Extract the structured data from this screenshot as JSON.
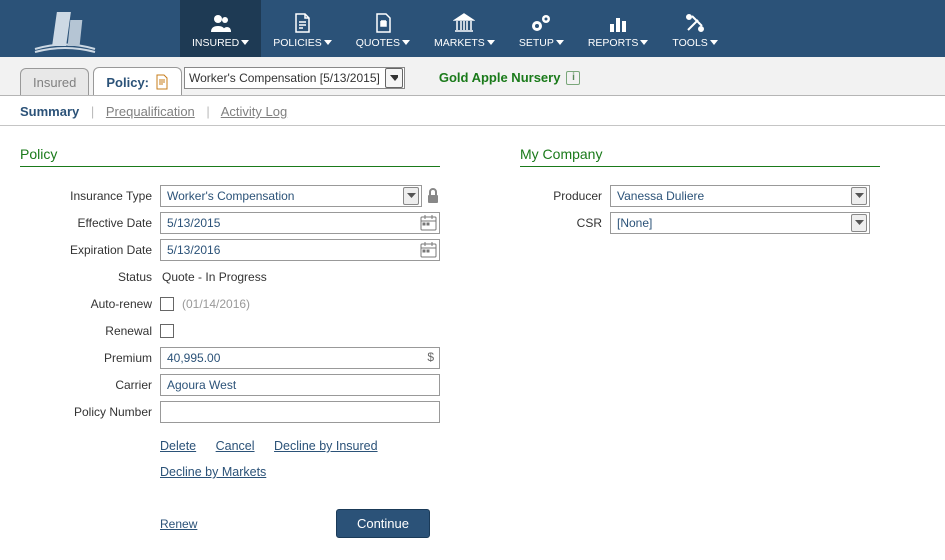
{
  "nav": {
    "items": [
      {
        "label": "INSURED"
      },
      {
        "label": "POLICIES"
      },
      {
        "label": "QUOTES"
      },
      {
        "label": "MARKETS"
      },
      {
        "label": "SETUP"
      },
      {
        "label": "REPORTS"
      },
      {
        "label": "TOOLS"
      }
    ]
  },
  "subtabs": {
    "insured": "Insured",
    "policy_label": "Policy:",
    "policy_selected": "Worker's Compensation [5/13/2015]",
    "company_name": "Gold Apple Nursery"
  },
  "tertiary": {
    "summary": "Summary",
    "prequal": "Prequalification",
    "activity": "Activity Log"
  },
  "policy": {
    "title": "Policy",
    "labels": {
      "insurance_type": "Insurance Type",
      "effective_date": "Effective Date",
      "expiration_date": "Expiration Date",
      "status": "Status",
      "auto_renew": "Auto-renew",
      "renewal": "Renewal",
      "premium": "Premium",
      "carrier": "Carrier",
      "policy_number": "Policy Number"
    },
    "values": {
      "insurance_type": "Worker's Compensation",
      "effective_date": "5/13/2015",
      "expiration_date": "5/13/2016",
      "status": "Quote - In Progress",
      "auto_renew_hint": "(01/14/2016)",
      "premium": "40,995.00",
      "carrier": "Agoura West",
      "policy_number": ""
    },
    "actions": {
      "delete": "Delete",
      "cancel": "Cancel",
      "decline_insured": "Decline by Insured",
      "decline_markets": "Decline by Markets",
      "renew": "Renew",
      "continue": "Continue"
    }
  },
  "company": {
    "title": "My Company",
    "labels": {
      "producer": "Producer",
      "csr": "CSR"
    },
    "values": {
      "producer": "Vanessa Duliere",
      "csr": "[None]"
    }
  }
}
